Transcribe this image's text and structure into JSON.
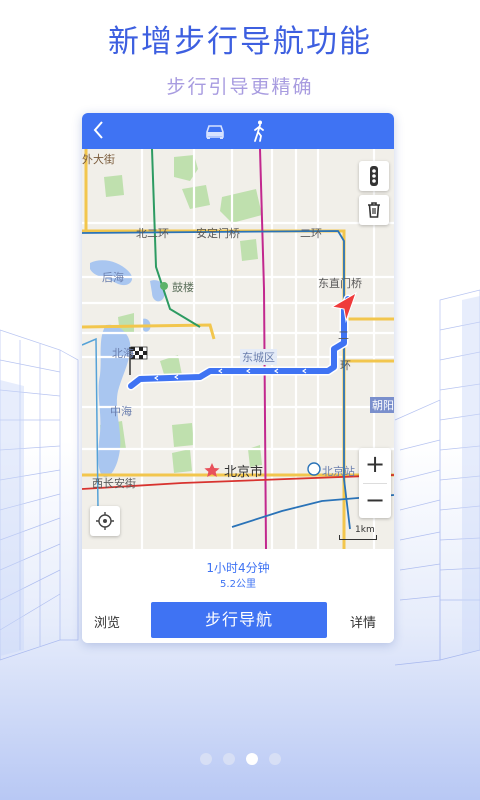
{
  "promo": {
    "headline": "新增步行导航功能",
    "subheadline": "步行引导更精确"
  },
  "topbar": {
    "back_icon": "chevron-left-icon",
    "modes": [
      "car-icon",
      "walking-person-icon"
    ],
    "active_mode": "walking"
  },
  "map": {
    "labels": {
      "beiersanhuan": "北二环",
      "andingmen": "安定门桥",
      "erhuan": "二环",
      "houhai": "后海",
      "gulou": "鼓楼",
      "dongzhimen": "东直门桥",
      "dongcheng": "东城区",
      "beihai": "北海",
      "zhonghai": "中海",
      "chaoyang": "朝阳",
      "xichang": "西长安街",
      "beijingshi": "北京市",
      "beijingzhan": "北京站",
      "left_edge": "外大街",
      "right_huan": "环",
      "right_er": "二"
    },
    "scale_label": "1km",
    "controls": [
      "traffic-light-icon",
      "trash-icon",
      "zoom-in-icon",
      "zoom-out-icon",
      "locate-icon"
    ],
    "zoom_in": "+",
    "zoom_out": "−"
  },
  "route": {
    "duration": "1小时4分钟",
    "distance": "5.2公里"
  },
  "actions": {
    "browse": "浏览",
    "navigate": "步行导航",
    "details": "详情"
  },
  "pager": {
    "count": 4,
    "active_index": 2
  },
  "colors": {
    "accent": "#3f73f3",
    "headline": "#3d5fe0",
    "subheadline": "#a89ce0",
    "route": "#3f73f3",
    "start_marker": "#ef3b3b"
  }
}
